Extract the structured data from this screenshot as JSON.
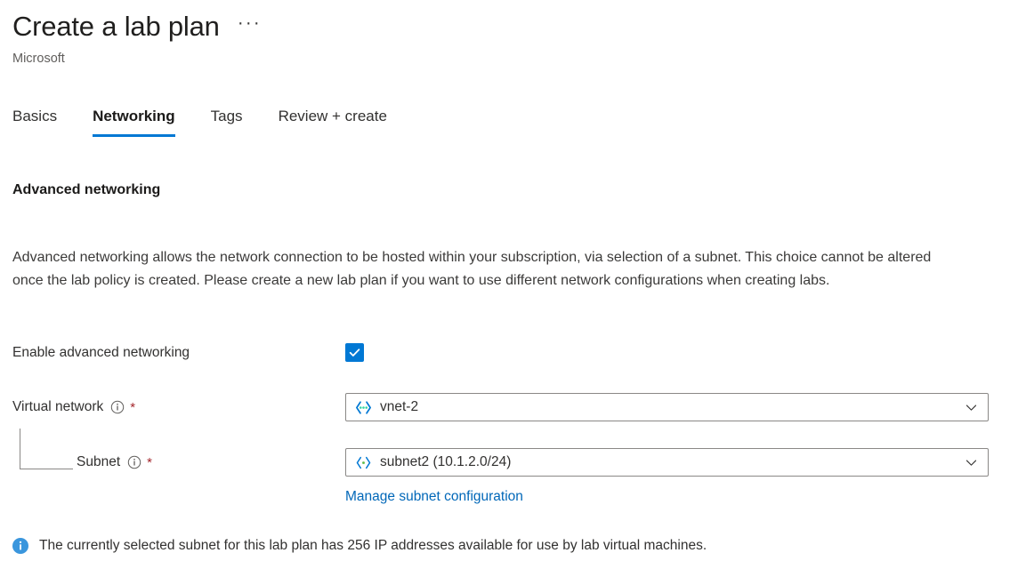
{
  "header": {
    "title": "Create a lab plan",
    "subtitle": "Microsoft",
    "menu_label": "···"
  },
  "tabs": [
    {
      "label": "Basics",
      "active": false
    },
    {
      "label": "Networking",
      "active": true
    },
    {
      "label": "Tags",
      "active": false
    },
    {
      "label": "Review + create",
      "active": false
    }
  ],
  "section": {
    "heading": "Advanced networking",
    "description": "Advanced networking allows the network connection to be hosted within your subscription, via selection of a subnet. This choice cannot be altered once the lab policy is created. Please create a new lab plan if you want to use different network configurations when creating labs."
  },
  "form": {
    "enable_advanced_networking": {
      "label": "Enable advanced networking",
      "checked": true,
      "icon": "checkmark-icon"
    },
    "virtual_network": {
      "label": "Virtual network",
      "required_marker": "*",
      "info_icon": "info-circle-icon",
      "value": "vnet-2",
      "resource_icon": "virtual-network-icon",
      "chevron_icon": "chevron-down-icon"
    },
    "subnet": {
      "label": "Subnet",
      "required_marker": "*",
      "info_icon": "info-circle-icon",
      "value": "subnet2 (10.1.2.0/24)",
      "resource_icon": "subnet-icon",
      "chevron_icon": "chevron-down-icon"
    },
    "manage_subnet_link": "Manage subnet configuration"
  },
  "info_message": {
    "icon": "info-filled-icon",
    "text": "The currently selected subnet for this lab plan has 256 IP addresses available for use by lab virtual machines."
  },
  "colors": {
    "accent": "#0078d4",
    "link": "#0067b8",
    "required": "#a4262c",
    "text": "#323130",
    "border": "#8a8886"
  }
}
